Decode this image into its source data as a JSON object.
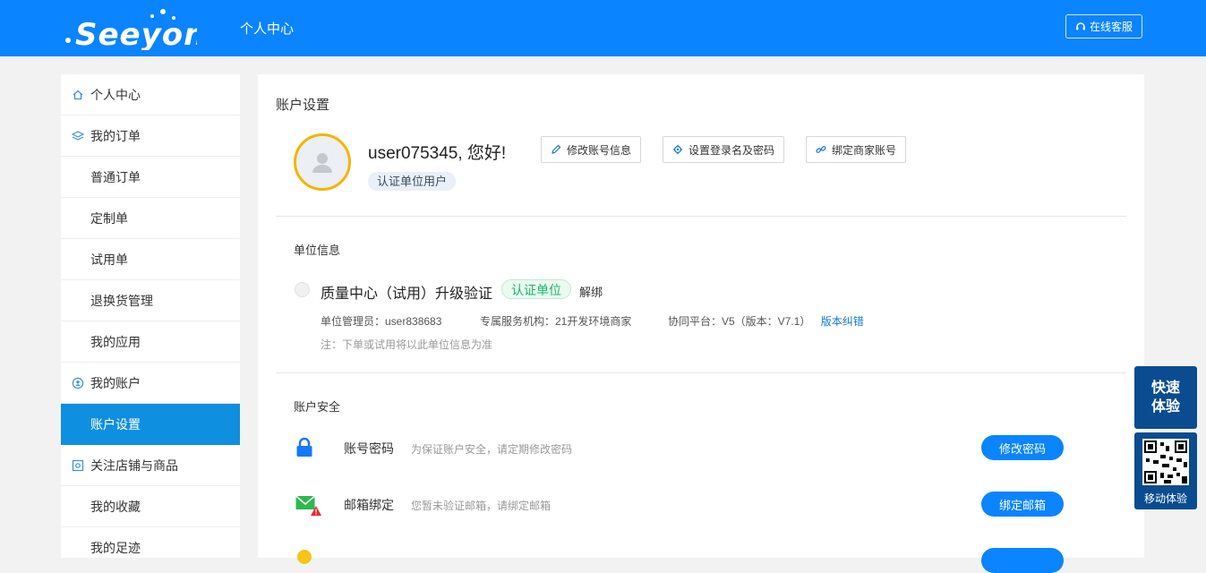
{
  "header": {
    "logo_text": "Seeyon",
    "title": "个人中心",
    "service_label": "在线客服"
  },
  "sidebar": {
    "items": [
      {
        "label": "个人中心",
        "icon": "home-icon"
      },
      {
        "label": "我的订单",
        "icon": "layers-icon"
      },
      {
        "label": "普通订单"
      },
      {
        "label": "定制单"
      },
      {
        "label": "试用单"
      },
      {
        "label": "退换货管理"
      },
      {
        "label": "我的应用"
      },
      {
        "label": "我的账户",
        "icon": "account-icon"
      },
      {
        "label": "账户设置",
        "active": true
      },
      {
        "label": "关注店铺与商品",
        "icon": "store-icon"
      },
      {
        "label": "我的收藏"
      },
      {
        "label": "我的足迹"
      }
    ]
  },
  "main": {
    "title": "账户设置",
    "greeting": "user075345, 您好!",
    "user_badge": "认证单位用户",
    "actions": {
      "edit_info": "修改账号信息",
      "set_login": "设置登录名及密码",
      "bind_merchant": "绑定商家账号"
    },
    "unit": {
      "section_title": "单位信息",
      "name": "质量中心（试用）升级验证",
      "badge": "认证单位",
      "unbind": "解绑",
      "admin": "单位管理员：user838683",
      "service_org": "专属服务机构：21开发环境商家",
      "platform": "协同平台：V5（版本：V7.1）",
      "platform_link": "版本纠错",
      "note": "注：下单或试用将以此单位信息为准"
    },
    "security": {
      "section_title": "账户安全",
      "rows": [
        {
          "label": "账号密码",
          "desc": "为保证账户安全，请定期修改密码",
          "button": "修改密码",
          "icon": "lock-icon"
        },
        {
          "label": "邮箱绑定",
          "desc": "您暂未验证邮箱，请绑定邮箱",
          "button": "绑定邮箱",
          "icon": "mail-warning-icon"
        }
      ]
    }
  },
  "floating": {
    "quick": "快速\n体验",
    "mobile": "移动体验"
  },
  "colors": {
    "brand": "#0a84ff",
    "sidebar_active": "#0f8fdf",
    "float_bg": "#0a4c8f",
    "verified_green": "#18b566"
  }
}
